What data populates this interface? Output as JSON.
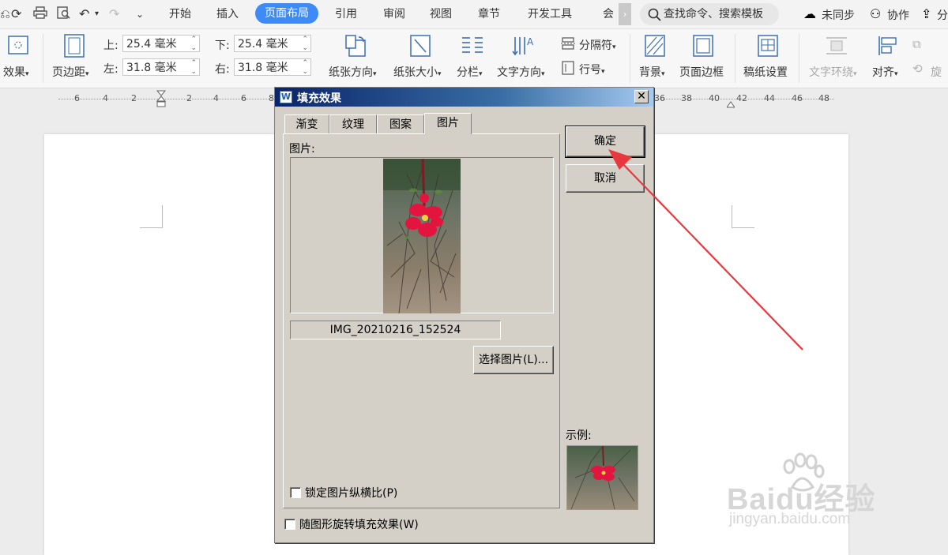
{
  "tabbar": {
    "tabs": [
      "开始",
      "插入",
      "页面布局",
      "引用",
      "审阅",
      "视图",
      "章节",
      "开发工具",
      "会"
    ],
    "active_tab": "页面布局",
    "search_placeholder": "查找命令、搜索模板",
    "sync_label": "未同步",
    "collab_label": "协作",
    "share_label": "分"
  },
  "ribbon": {
    "effect_label": "效果",
    "margin_label": "页边距",
    "top_label": "上:",
    "top_value": "25.4 毫米",
    "bottom_label": "下:",
    "bottom_value": "25.4 毫米",
    "left_label": "左:",
    "left_value": "31.8 毫米",
    "right_label": "右:",
    "right_value": "31.8 毫米",
    "orientation_label": "纸张方向",
    "size_label": "纸张大小",
    "columns_label": "分栏",
    "text_direction_label": "文字方向",
    "separator_label": "分隔符",
    "line_number_label": "行号",
    "background_label": "背景",
    "page_border_label": "页面边框",
    "grid_paper_label": "稿纸设置",
    "text_wrap_label": "文字环绕",
    "align_label": "对齐",
    "rotate_label": "旋"
  },
  "ruler": {
    "ticks": [
      "6",
      "4",
      "2",
      "2",
      "4",
      "6",
      "8",
      "36",
      "38",
      "40",
      "42",
      "44",
      "46",
      "48"
    ]
  },
  "dialog": {
    "title": "填充效果",
    "tabs": [
      "渐变",
      "纹理",
      "图案",
      "图片"
    ],
    "active_tab": "图片",
    "picture_label": "图片:",
    "file_name": "IMG_20210216_152524",
    "select_button": "选择图片(L)...",
    "lock_ratio_label": "锁定图片纵横比(P)",
    "rotate_fill_label": "随图形旋转填充效果(W)",
    "ok_button": "确定",
    "cancel_button": "取消",
    "sample_label": "示例:",
    "close_symbol": "✕"
  },
  "watermark": {
    "logo_text": "Baidu经验",
    "url": "jingyan.baidu.com"
  },
  "colors": {
    "accent": "#3e8af6",
    "dialog_face": "#d4d0c8",
    "title_bar": "#0a246a",
    "arrow": "#e8383d"
  }
}
